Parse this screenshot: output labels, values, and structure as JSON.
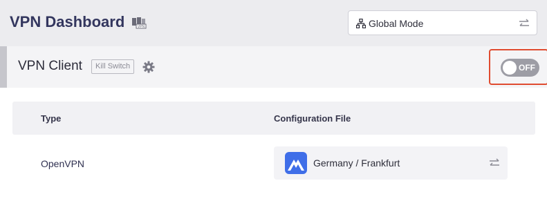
{
  "header": {
    "title": "VPN Dashboard",
    "mode_select": {
      "value": "Global Mode",
      "icon": "network-icon"
    }
  },
  "client": {
    "title": "VPN Client",
    "kill_switch_label": "Kill Switch",
    "toggle": {
      "state_label": "OFF",
      "is_on": false
    }
  },
  "table": {
    "columns": [
      "Type",
      "Configuration File"
    ],
    "rows": [
      {
        "type": "OpenVPN",
        "config": "Germany / Frankfurt",
        "provider_icon": "mountain-logo-icon"
      }
    ]
  },
  "colors": {
    "title": "#33365e",
    "highlight_border": "#e04b2f",
    "provider_blue": "#3f6ee8",
    "toggle_off": "#9d9da5"
  }
}
